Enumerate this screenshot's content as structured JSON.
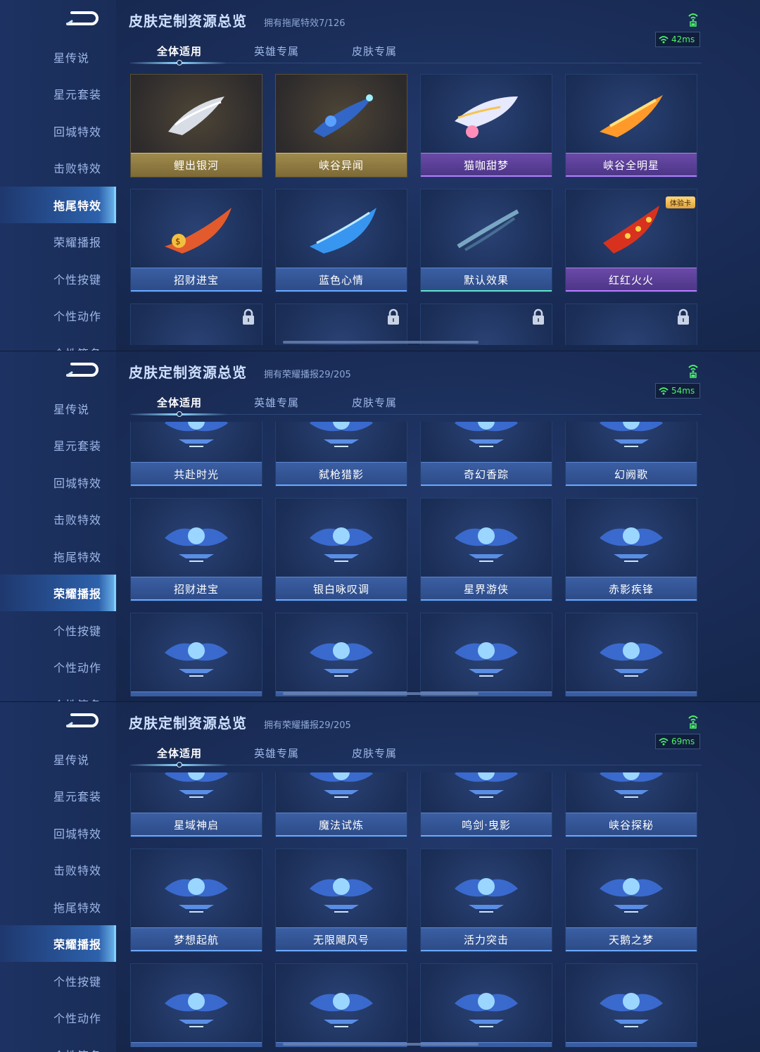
{
  "panels": [
    {
      "title": "皮肤定制资源总览",
      "subtitle_prefix": "拥有拖尾特效",
      "subtitle_count": "7/126",
      "ping": "42ms",
      "active_menu": 4,
      "tabs": [
        "全体适用",
        "英雄专属",
        "皮肤专属"
      ],
      "menu": [
        "星传说",
        "星元套装",
        "回城特效",
        "击败特效",
        "拖尾特效",
        "荣耀播报",
        "个性按键",
        "个性动作",
        "个性签名"
      ],
      "cards": [
        {
          "label": "鲤出银河",
          "style": "gold",
          "art": "silver-koi-trail"
        },
        {
          "label": "峡谷异闻",
          "style": "gold",
          "art": "blue-butterfly-trail"
        },
        {
          "label": "猫咖甜梦",
          "style": "purple",
          "art": "candy-cat-trail"
        },
        {
          "label": "峡谷全明星",
          "style": "purple",
          "art": "flame-star-trail"
        },
        {
          "label": "招财进宝",
          "style": "blue",
          "art": "fortune-trail"
        },
        {
          "label": "蓝色心情",
          "style": "blue",
          "art": "blue-wave-trail"
        },
        {
          "label": "默认效果",
          "style": "teal",
          "art": "default-trail"
        },
        {
          "label": "红红火火",
          "style": "purple",
          "art": "red-fire-trail",
          "badge": "体验卡"
        },
        {
          "label": "",
          "style": "blue",
          "locked": true
        },
        {
          "label": "",
          "style": "blue",
          "locked": true
        },
        {
          "label": "",
          "style": "blue",
          "locked": true
        },
        {
          "label": "",
          "style": "blue",
          "locked": true
        }
      ]
    },
    {
      "title": "皮肤定制资源总览",
      "subtitle_prefix": "拥有荣耀播报",
      "subtitle_count": "29/205",
      "ping": "54ms",
      "active_menu": 5,
      "tabs": [
        "全体适用",
        "英雄专属",
        "皮肤专属"
      ],
      "menu": [
        "星传说",
        "星元套装",
        "回城特效",
        "击败特效",
        "拖尾特效",
        "荣耀播报",
        "个性按键",
        "个性动作",
        "个性签名"
      ],
      "cards": [
        {
          "label": "共赴时光",
          "style": "blue",
          "art": "broadcast-emblem"
        },
        {
          "label": "弑枪猎影",
          "style": "blue",
          "art": "broadcast-emblem"
        },
        {
          "label": "奇幻香踪",
          "style": "blue",
          "art": "broadcast-emblem"
        },
        {
          "label": "幻阙歌",
          "style": "blue",
          "art": "broadcast-emblem"
        },
        {
          "label": "招财进宝",
          "style": "blue",
          "art": "broadcast-emblem"
        },
        {
          "label": "银白咏叹调",
          "style": "blue",
          "art": "broadcast-emblem"
        },
        {
          "label": "星界游侠",
          "style": "blue",
          "art": "broadcast-emblem"
        },
        {
          "label": "赤影疾锋",
          "style": "blue",
          "art": "broadcast-emblem"
        },
        {
          "label": "",
          "style": "blue",
          "art": "broadcast-emblem"
        },
        {
          "label": "",
          "style": "blue",
          "art": "broadcast-emblem"
        },
        {
          "label": "",
          "style": "blue",
          "art": "broadcast-emblem"
        },
        {
          "label": "",
          "style": "blue",
          "art": "broadcast-emblem"
        }
      ]
    },
    {
      "title": "皮肤定制资源总览",
      "subtitle_prefix": "拥有荣耀播报",
      "subtitle_count": "29/205",
      "ping": "69ms",
      "active_menu": 5,
      "tabs": [
        "全体适用",
        "英雄专属",
        "皮肤专属"
      ],
      "menu": [
        "星传说",
        "星元套装",
        "回城特效",
        "击败特效",
        "拖尾特效",
        "荣耀播报",
        "个性按键",
        "个性动作",
        "个性签名"
      ],
      "cards": [
        {
          "label": "星域神启",
          "style": "blue",
          "art": "broadcast-emblem"
        },
        {
          "label": "魔法试炼",
          "style": "blue",
          "art": "broadcast-emblem"
        },
        {
          "label": "鸣剑·曳影",
          "style": "blue",
          "art": "broadcast-emblem"
        },
        {
          "label": "峡谷探秘",
          "style": "blue",
          "art": "broadcast-emblem"
        },
        {
          "label": "梦想起航",
          "style": "blue",
          "art": "broadcast-emblem"
        },
        {
          "label": "无限飓风号",
          "style": "blue",
          "art": "broadcast-emblem"
        },
        {
          "label": "活力突击",
          "style": "blue",
          "art": "broadcast-emblem"
        },
        {
          "label": "天鹅之梦",
          "style": "blue",
          "art": "broadcast-emblem"
        },
        {
          "label": "",
          "style": "blue",
          "art": "broadcast-emblem"
        },
        {
          "label": "",
          "style": "blue",
          "art": "broadcast-emblem"
        },
        {
          "label": "",
          "style": "blue",
          "art": "broadcast-emblem"
        },
        {
          "label": "",
          "style": "blue",
          "art": "broadcast-emblem"
        }
      ]
    }
  ],
  "colors": {
    "ping_green": "#4cf06a",
    "accent_blue": "#8fd8ff",
    "gold_label": "#a08a4c",
    "purple_label": "#6a4aa8"
  }
}
